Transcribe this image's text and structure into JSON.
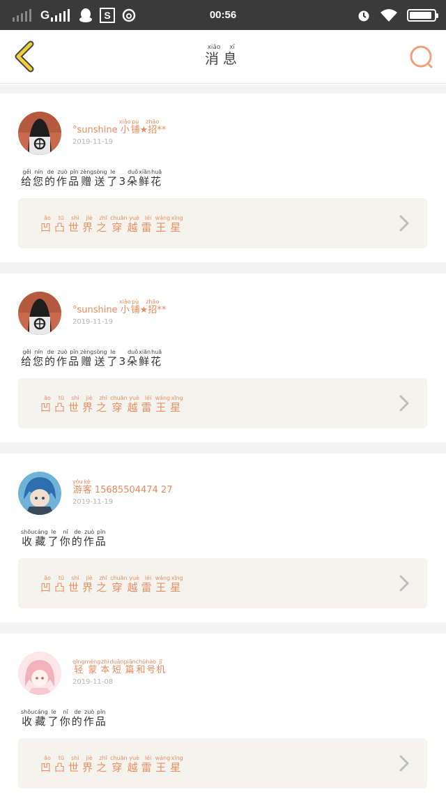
{
  "status_bar": {
    "network": "G",
    "time": "00:56",
    "battery_level": 0.92
  },
  "header": {
    "title": [
      {
        "char": "消",
        "pinyin": "xiāo"
      },
      {
        "char": "息",
        "pinyin": "xī"
      }
    ]
  },
  "messages": [
    {
      "avatar": "avatar-dark-hair",
      "username_prefix": "°sunshine",
      "username": [
        {
          "char": "小",
          "pinyin": "xiǎo"
        },
        {
          "char": "铺",
          "pinyin": "pù"
        },
        {
          "char": "★",
          "pinyin": ""
        },
        {
          "char": "招",
          "pinyin": "zhāo"
        },
        {
          "char": "**",
          "pinyin": ""
        }
      ],
      "date": "2019-11-19",
      "action": [
        {
          "char": "给",
          "pinyin": "gěi"
        },
        {
          "char": "您",
          "pinyin": "nín"
        },
        {
          "char": "的",
          "pinyin": "de"
        },
        {
          "char": "作",
          "pinyin": "zuò"
        },
        {
          "char": "品",
          "pinyin": "pǐn"
        },
        {
          "char": "赠",
          "pinyin": "zèng"
        },
        {
          "char": "送",
          "pinyin": "sòng"
        },
        {
          "char": "了",
          "pinyin": "le"
        },
        {
          "char": "3",
          "pinyin": ""
        },
        {
          "char": "朵",
          "pinyin": "duǒ"
        },
        {
          "char": "鲜",
          "pinyin": "xiān"
        },
        {
          "char": "花",
          "pinyin": "huā"
        }
      ],
      "work_title": [
        {
          "char": "凹",
          "pinyin": "āo"
        },
        {
          "char": "凸",
          "pinyin": "tū"
        },
        {
          "char": "世",
          "pinyin": "shì"
        },
        {
          "char": "界",
          "pinyin": "jiè"
        },
        {
          "char": "之",
          "pinyin": "zhī"
        },
        {
          "char": "穿",
          "pinyin": "chuān"
        },
        {
          "char": "越",
          "pinyin": "yuè"
        },
        {
          "char": "雷",
          "pinyin": "léi"
        },
        {
          "char": "王",
          "pinyin": "wáng"
        },
        {
          "char": "星",
          "pinyin": "xīng"
        }
      ]
    },
    {
      "avatar": "avatar-dark-hair",
      "username_prefix": "°sunshine",
      "username": [
        {
          "char": "小",
          "pinyin": "xiǎo"
        },
        {
          "char": "铺",
          "pinyin": "pù"
        },
        {
          "char": "★",
          "pinyin": ""
        },
        {
          "char": "招",
          "pinyin": "zhāo"
        },
        {
          "char": "**",
          "pinyin": ""
        }
      ],
      "date": "2019-11-19",
      "action": [
        {
          "char": "给",
          "pinyin": "gěi"
        },
        {
          "char": "您",
          "pinyin": "nín"
        },
        {
          "char": "的",
          "pinyin": "de"
        },
        {
          "char": "作",
          "pinyin": "zuò"
        },
        {
          "char": "品",
          "pinyin": "pǐn"
        },
        {
          "char": "赠",
          "pinyin": "zèng"
        },
        {
          "char": "送",
          "pinyin": "sòng"
        },
        {
          "char": "了",
          "pinyin": "le"
        },
        {
          "char": "3",
          "pinyin": ""
        },
        {
          "char": "朵",
          "pinyin": "duǒ"
        },
        {
          "char": "鲜",
          "pinyin": "xiān"
        },
        {
          "char": "花",
          "pinyin": "huā"
        }
      ],
      "work_title": [
        {
          "char": "凹",
          "pinyin": "āo"
        },
        {
          "char": "凸",
          "pinyin": "tū"
        },
        {
          "char": "世",
          "pinyin": "shì"
        },
        {
          "char": "界",
          "pinyin": "jiè"
        },
        {
          "char": "之",
          "pinyin": "zhī"
        },
        {
          "char": "穿",
          "pinyin": "chuān"
        },
        {
          "char": "越",
          "pinyin": "yuè"
        },
        {
          "char": "雷",
          "pinyin": "léi"
        },
        {
          "char": "王",
          "pinyin": "wáng"
        },
        {
          "char": "星",
          "pinyin": "xīng"
        }
      ]
    },
    {
      "avatar": "avatar-blue-hair",
      "username_prefix": "",
      "username": [
        {
          "char": "游",
          "pinyin": "yóu"
        },
        {
          "char": "客",
          "pinyin": "kè"
        },
        {
          "char": " 15685504474 27",
          "pinyin": ""
        }
      ],
      "date": "2019-11-19",
      "action": [
        {
          "char": "收",
          "pinyin": "shōu"
        },
        {
          "char": "藏",
          "pinyin": "cáng"
        },
        {
          "char": "了",
          "pinyin": "le"
        },
        {
          "char": "你",
          "pinyin": "nǐ"
        },
        {
          "char": "的",
          "pinyin": "de"
        },
        {
          "char": "作",
          "pinyin": "zuò"
        },
        {
          "char": "品",
          "pinyin": "pǐn"
        }
      ],
      "work_title": [
        {
          "char": "凹",
          "pinyin": "āo"
        },
        {
          "char": "凸",
          "pinyin": "tū"
        },
        {
          "char": "世",
          "pinyin": "shì"
        },
        {
          "char": "界",
          "pinyin": "jiè"
        },
        {
          "char": "之",
          "pinyin": "zhī"
        },
        {
          "char": "穿",
          "pinyin": "chuān"
        },
        {
          "char": "越",
          "pinyin": "yuè"
        },
        {
          "char": "雷",
          "pinyin": "léi"
        },
        {
          "char": "王",
          "pinyin": "wáng"
        },
        {
          "char": "星",
          "pinyin": "xīng"
        }
      ]
    },
    {
      "avatar": "avatar-pink-hair",
      "username_prefix": "",
      "username": [
        {
          "char": "轻",
          "pinyin": "qīng"
        },
        {
          "char": "蒙",
          "pinyin": "méng"
        },
        {
          "char": "本",
          "pinyin": "zhì"
        },
        {
          "char": "短",
          "pinyin": "duǎn"
        },
        {
          "char": "篇",
          "pinyin": "piān"
        },
        {
          "char": "和",
          "pinyin": "chū"
        },
        {
          "char": "号",
          "pinyin": "hào"
        },
        {
          "char": "机",
          "pinyin": "jī"
        }
      ],
      "date": "2019-11-08",
      "action": [
        {
          "char": "收",
          "pinyin": "shōu"
        },
        {
          "char": "藏",
          "pinyin": "cáng"
        },
        {
          "char": "了",
          "pinyin": "le"
        },
        {
          "char": "你",
          "pinyin": "nǐ"
        },
        {
          "char": "的",
          "pinyin": "de"
        },
        {
          "char": "作",
          "pinyin": "zuò"
        },
        {
          "char": "品",
          "pinyin": "pǐn"
        }
      ],
      "work_title": [
        {
          "char": "凹",
          "pinyin": "āo"
        },
        {
          "char": "凸",
          "pinyin": "tū"
        },
        {
          "char": "世",
          "pinyin": "shì"
        },
        {
          "char": "界",
          "pinyin": "jiè"
        },
        {
          "char": "之",
          "pinyin": "zhī"
        },
        {
          "char": "穿",
          "pinyin": "chuān"
        },
        {
          "char": "越",
          "pinyin": "yuè"
        },
        {
          "char": "雷",
          "pinyin": "léi"
        },
        {
          "char": "王",
          "pinyin": "wáng"
        },
        {
          "char": "星",
          "pinyin": "xīng"
        }
      ]
    }
  ],
  "colors": {
    "accent": "#eb8f60",
    "status_bar": "#3a3a3a",
    "card_box": "#f4f3ee",
    "back_arrow": "#f0cf3a"
  }
}
